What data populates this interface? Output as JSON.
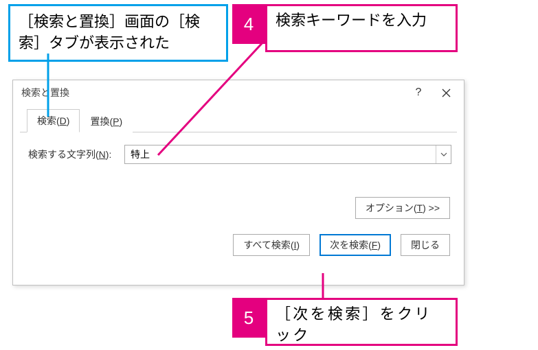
{
  "callouts": {
    "blue": "［検索と置換］画面の［検索］タブが表示された",
    "step4_num": "4",
    "step4_text": "検索キーワードを入力",
    "step5_num": "5",
    "step5_text": "［次を検索］をクリック"
  },
  "dialog": {
    "title": "検索と置換",
    "help": "?",
    "tabs": {
      "search": "検索(D)",
      "replace": "置換(P)"
    },
    "form": {
      "label": "検索する文字列(N):",
      "value": "特上"
    },
    "buttons": {
      "options": "オプション(T) >>",
      "find_all": "すべて検索(I)",
      "find_next": "次を検索(F)",
      "close": "閉じる"
    }
  }
}
